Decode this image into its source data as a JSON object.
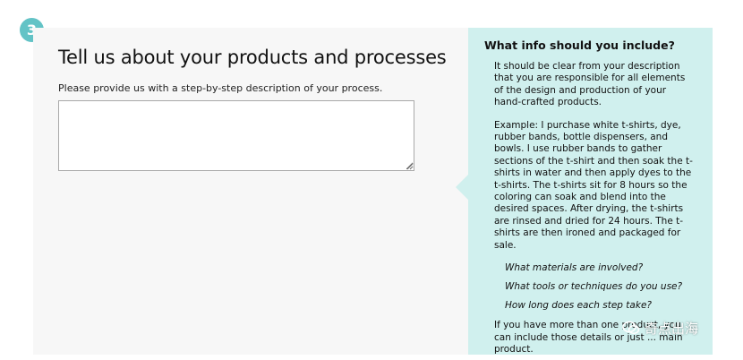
{
  "step": {
    "number": "3"
  },
  "section": {
    "title": "Tell us about your products and processes",
    "prompt": "Please provide us with a step-by-step description of your process.",
    "textarea_value": ""
  },
  "info": {
    "title": "What info should you include?",
    "paragraph1": "It should be clear from your description that you are responsible for all elements of the design and production of your hand-crafted products.",
    "example": "Example: I purchase white t-shirts, dye, rubber bands, bottle dispensers, and bowls. I use rubber bands to gather sections of the t-shirt and then soak the t-shirts in water and then apply dyes to the t-shirts. The t-shirts sit for 8 hours so the coloring can soak and blend into the desired spaces. After drying, the t-shirts are rinsed and dried for 24 hours. The t-shirts are then ironed and packaged for sale.",
    "questions": [
      "What materials are involved?",
      "What tools or techniques do you use?",
      "How long does each step take?"
    ],
    "footer": "If you have more than one product, you can include those details or just ... main product."
  },
  "watermark": {
    "text": "奇点出海",
    "icon": "wechat-icon"
  },
  "colors": {
    "accent": "#63c3c6",
    "info_bg": "#d0f0ee",
    "panel_bg": "#f7f7f7"
  }
}
